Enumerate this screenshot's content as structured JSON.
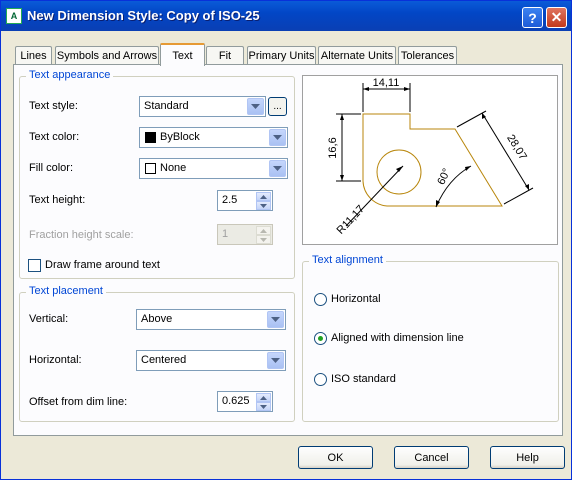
{
  "window": {
    "title": "New Dimension Style: Copy of ISO-25",
    "app_icon": "autocad-app-icon",
    "help_glyph": "?",
    "close_glyph": "✕"
  },
  "tabs": [
    {
      "label": "Lines"
    },
    {
      "label": "Symbols and Arrows"
    },
    {
      "label": "Text",
      "active": true
    },
    {
      "label": "Fit"
    },
    {
      "label": "Primary Units"
    },
    {
      "label": "Alternate Units"
    },
    {
      "label": "Tolerances"
    }
  ],
  "text_appearance": {
    "legend": "Text appearance",
    "text_style": {
      "label": "Text style:",
      "value": "Standard",
      "browse": "..."
    },
    "text_color": {
      "label": "Text color:",
      "value": "ByBlock"
    },
    "fill_color": {
      "label": "Fill color:",
      "value": "None"
    },
    "text_height": {
      "label": "Text height:",
      "value": "2.5"
    },
    "fraction_height": {
      "label": "Fraction height scale:",
      "value": "1"
    },
    "draw_frame": {
      "label": "Draw frame around text",
      "checked": false
    }
  },
  "text_placement": {
    "legend": "Text placement",
    "vertical": {
      "label": "Vertical:",
      "value": "Above"
    },
    "horizontal": {
      "label": "Horizontal:",
      "value": "Centered"
    },
    "offset": {
      "label": "Offset from dim line:",
      "value": "0.625"
    }
  },
  "preview": {
    "dim_top": "14,11",
    "dim_left": "16,6",
    "dim_right": "28,07",
    "dim_angle": "60°",
    "dim_radius": "R11,17"
  },
  "text_alignment": {
    "legend": "Text alignment",
    "options": [
      {
        "label": "Horizontal",
        "checked": false
      },
      {
        "label": "Aligned with dimension line",
        "checked": true
      },
      {
        "label": "ISO standard",
        "checked": false
      }
    ]
  },
  "buttons": {
    "ok": "OK",
    "cancel": "Cancel",
    "help": "Help"
  },
  "colors": {
    "titlebar": "#0246c6",
    "legend_text": "#0046d5",
    "active_tab_accent": "#e69a34",
    "preview_geometry": "#b8860b"
  }
}
